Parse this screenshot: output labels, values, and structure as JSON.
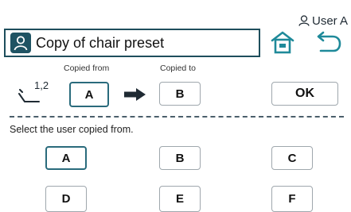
{
  "header": {
    "user_label": "User A",
    "title": "Copy of chair preset"
  },
  "copy": {
    "seat_number": "1,2",
    "from_label": "Copied from",
    "to_label": "Copied to",
    "from_value": "A",
    "to_value": "B",
    "ok_label": "OK"
  },
  "selection": {
    "instruction": "Select the user copied from.",
    "users": [
      "A",
      "B",
      "C",
      "D",
      "E",
      "F"
    ],
    "selected": "A"
  },
  "colors": {
    "accent": "#1f5363",
    "selected_border": "#2a6b7c",
    "home_icon": "#1f8a9a",
    "back_icon": "#1f8a9a"
  }
}
